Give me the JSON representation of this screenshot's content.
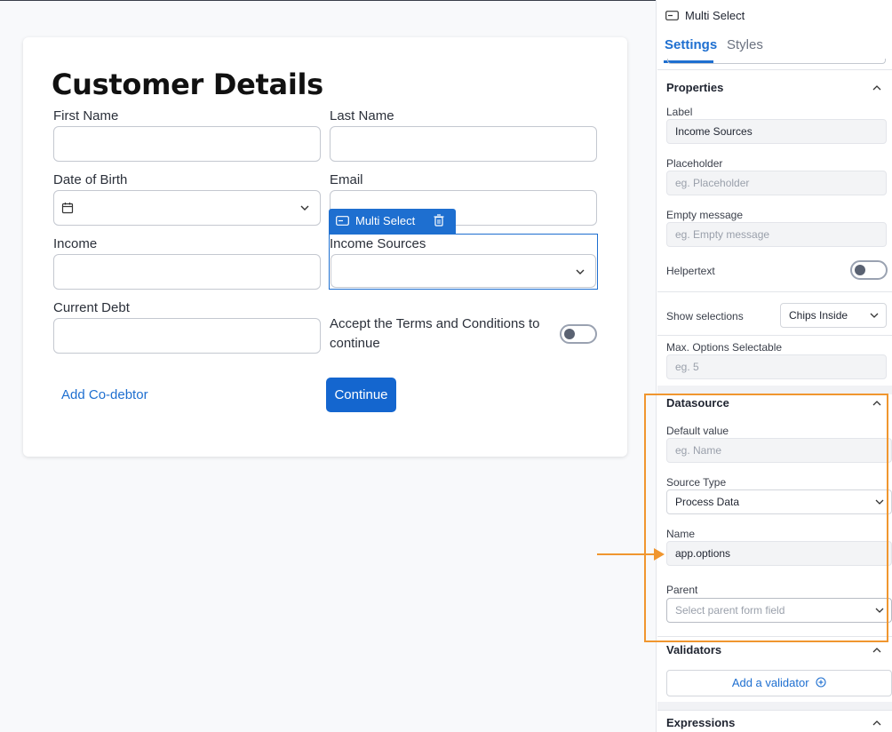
{
  "form": {
    "title": "Customer Details",
    "fields": {
      "first_name": "First Name",
      "last_name": "Last Name",
      "date_of_birth": "Date of Birth",
      "email": "Email",
      "income": "Income",
      "income_sources": "Income Sources",
      "current_debt": "Current Debt",
      "terms": "Accept the Terms and Conditions to continue"
    },
    "selected_tag": "Multi Select",
    "add_codebtor": "Add Co-debtor",
    "continue": "Continue"
  },
  "panel": {
    "header": "Multi Select",
    "tabs": [
      "Settings",
      "Styles"
    ],
    "properties": {
      "title": "Properties",
      "label_label": "Label",
      "label_value": "Income Sources",
      "placeholder_label": "Placeholder",
      "placeholder_ph": "eg. Placeholder",
      "empty_label": "Empty message",
      "empty_ph": "eg. Empty message",
      "helpertext_label": "Helpertext",
      "show_selections_label": "Show selections",
      "show_selections_value": "Chips Inside",
      "max_label": "Max. Options Selectable",
      "max_ph": "eg. 5"
    },
    "datasource": {
      "title": "Datasource",
      "default_label": "Default value",
      "default_ph": "eg. Name",
      "source_type_label": "Source Type",
      "source_type_value": "Process Data",
      "name_label": "Name",
      "name_value": "app.options",
      "parent_label": "Parent",
      "parent_ph": "Select parent form field"
    },
    "validators": {
      "title": "Validators",
      "add": "Add a validator"
    },
    "expressions": {
      "title": "Expressions"
    }
  },
  "colors": {
    "accent": "#1e6fd0",
    "highlight": "#f0962f"
  }
}
